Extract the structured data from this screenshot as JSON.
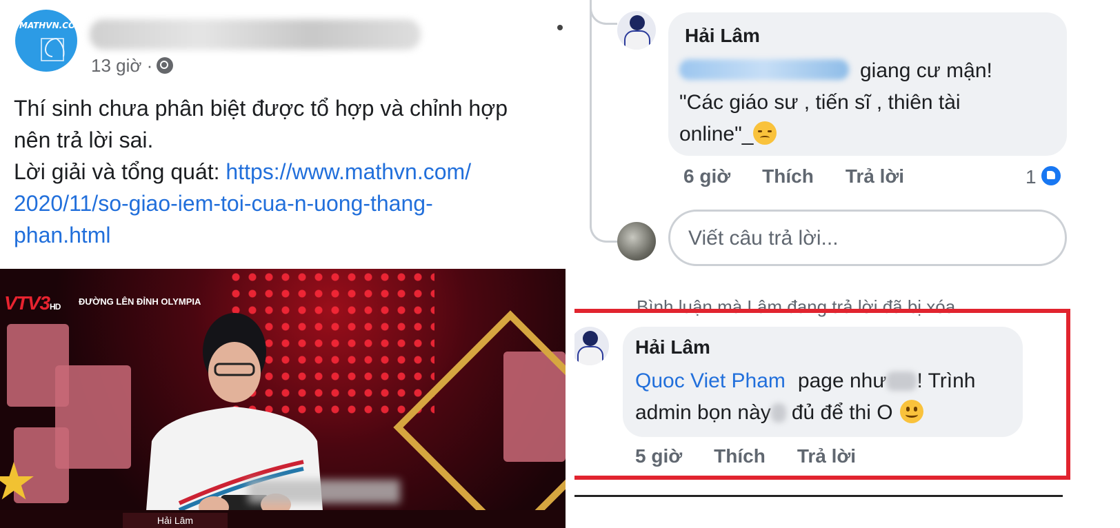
{
  "left_post": {
    "page_logo_text": "MATHVN.COM",
    "time": "13 giờ ·",
    "text_line1": "Thí sinh chưa phân biệt được tổ hợp và chỉnh hợp",
    "text_line2": "nên trả lời sai.",
    "text_line3_prefix": "Lời giải và tổng quát: ",
    "link_part1": "https://www.mathvn.com/",
    "link_part2": "2020/11/so-giao-iem-toi-cua-n-uong-thang-",
    "link_part3": "phan.html",
    "video": {
      "channel_logo": "VTV3",
      "channel_hd": "HD",
      "show_title": "ĐƯỜNG LÊN ĐỈNH OLYMPIA",
      "nameplate": "Hải Lâm"
    }
  },
  "right_comments": {
    "comment1": {
      "author": "Hải Lâm",
      "text_after_mention": "giang cư mận!",
      "text_line2": "\"Các giáo sư , tiến sĩ , thiên tài",
      "text_line3": "online\"_",
      "time": "6 giờ",
      "like": "Thích",
      "reply": "Trả lời",
      "like_count": "1"
    },
    "reply_placeholder": "Viết câu trả lời...",
    "deleted_note": "Bình luận mà Lâm đang trả lời đã bị xóa",
    "comment2": {
      "author": "Hải Lâm",
      "mention": "Quoc Viet Pham",
      "text_part1": "page như",
      "text_part2": "! Trình",
      "text_line2a": "admin bọn này",
      "text_line2b": "đủ để thi O",
      "time": "5 giờ",
      "like": "Thích",
      "reply": "Trả lời"
    }
  },
  "colors": {
    "link": "#216fdb",
    "highlight_border": "#e1242f",
    "bubble": "#eff1f4",
    "like_blue": "#1877f2"
  }
}
